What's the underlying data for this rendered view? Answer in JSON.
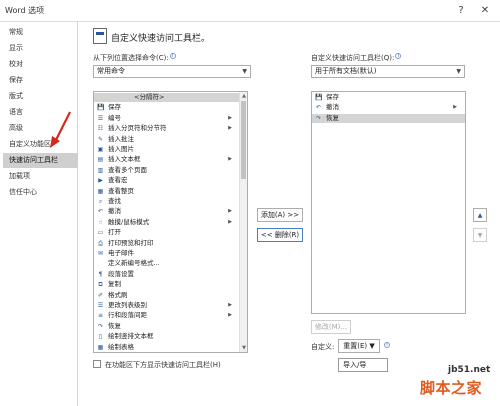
{
  "window": {
    "title": "Word 选项",
    "help_glyph": "?",
    "close_glyph": "✕"
  },
  "sidebar": {
    "items": [
      {
        "label": "常规"
      },
      {
        "label": "显示"
      },
      {
        "label": "校对"
      },
      {
        "label": "保存"
      },
      {
        "label": "版式"
      },
      {
        "label": "语言"
      },
      {
        "label": "高级"
      },
      {
        "label": "自定义功能区"
      },
      {
        "label": "快速访问工具栏",
        "selected": true
      },
      {
        "label": "加载项"
      },
      {
        "label": "信任中心"
      }
    ]
  },
  "main": {
    "title": "自定义快速访问工具栏。",
    "choose_from_label": "从下列位置选择命令(C):",
    "choose_from_value": "常用命令",
    "customize_label": "自定义快速访问工具栏(Q):",
    "customize_value": "用于所有文档(默认)",
    "info_glyph": "i",
    "dropdown_glyph": "▼",
    "submenu_glyph": "▶",
    "up_glyph": "▲",
    "down_glyph": "▼",
    "commands": [
      {
        "label": "<分隔符>",
        "icon": "",
        "separator": true
      },
      {
        "label": "保存",
        "icon": "💾",
        "icon_name": "save-icon"
      },
      {
        "label": "编号",
        "icon": "☰",
        "icon_name": "numbering-icon",
        "submenu": true
      },
      {
        "label": "插入分页符和分节符",
        "icon": "☷",
        "icon_name": "page-break-icon",
        "submenu": true
      },
      {
        "label": "插入批注",
        "icon": "✎",
        "icon_name": "comment-icon"
      },
      {
        "label": "插入图片",
        "icon": "▣",
        "icon_name": "picture-icon"
      },
      {
        "label": "插入文本框",
        "icon": "▤",
        "icon_name": "textbox-icon",
        "submenu": true
      },
      {
        "label": "查看多个页面",
        "icon": "▥",
        "icon_name": "multi-page-icon"
      },
      {
        "label": "查看宏",
        "icon": "▶",
        "icon_name": "macro-icon"
      },
      {
        "label": "查看整页",
        "icon": "▦",
        "icon_name": "full-page-icon"
      },
      {
        "label": "查找",
        "icon": "⌕",
        "icon_name": "find-icon"
      },
      {
        "label": "撤消",
        "icon": "↶",
        "icon_name": "undo-icon",
        "submenu": true
      },
      {
        "label": "触摸/鼠标模式",
        "icon": "☝",
        "icon_name": "touch-mode-icon",
        "submenu": true
      },
      {
        "label": "打开",
        "icon": "▭",
        "icon_name": "open-icon"
      },
      {
        "label": "打印预览和打印",
        "icon": "⎙",
        "icon_name": "print-preview-icon"
      },
      {
        "label": "电子邮件",
        "icon": "✉",
        "icon_name": "email-icon"
      },
      {
        "label": "定义新编号格式...",
        "icon": "",
        "icon_name": ""
      },
      {
        "label": "段落设置",
        "icon": "¶",
        "icon_name": "paragraph-icon"
      },
      {
        "label": "复制",
        "icon": "⧉",
        "icon_name": "copy-icon"
      },
      {
        "label": "格式刷",
        "icon": "✐",
        "icon_name": "format-painter-icon"
      },
      {
        "label": "更改列表级别",
        "icon": "☰",
        "icon_name": "list-level-icon",
        "submenu": true
      },
      {
        "label": "行和段落间距",
        "icon": "≡",
        "icon_name": "line-spacing-icon",
        "submenu": true
      },
      {
        "label": "恢复",
        "icon": "↷",
        "icon_name": "redo-icon"
      },
      {
        "label": "绘制竖排文本框",
        "icon": "▯",
        "icon_name": "vertical-textbox-icon"
      },
      {
        "label": "绘制表格",
        "icon": "▦",
        "icon_name": "draw-table-icon"
      }
    ],
    "toolbar_items": [
      {
        "label": "保存",
        "icon": "💾",
        "icon_name": "save-icon"
      },
      {
        "label": "撤消",
        "icon": "↶",
        "icon_name": "undo-icon",
        "submenu": true
      },
      {
        "label": "恢复",
        "icon": "↷",
        "icon_name": "redo-icon",
        "selected": true
      }
    ],
    "add_button": "添加(A) >>",
    "remove_button": "<< 删除(R)",
    "modify_button": "修改(M)...",
    "customize_row_label": "自定义:",
    "reset_button": "重置(E) ▼",
    "import_export_option": "导入/导",
    "show_below_ribbon_label": "在功能区下方显示快速访问工具栏(H)"
  },
  "watermark": {
    "url": "jb51.net",
    "logo": "脚本之家"
  },
  "colors": {
    "annotation_arrow": "#d9261c",
    "selected_nav": "#cfcfcf",
    "highlight_row": "#d4d4d4",
    "watermark": "#e15a1e"
  }
}
